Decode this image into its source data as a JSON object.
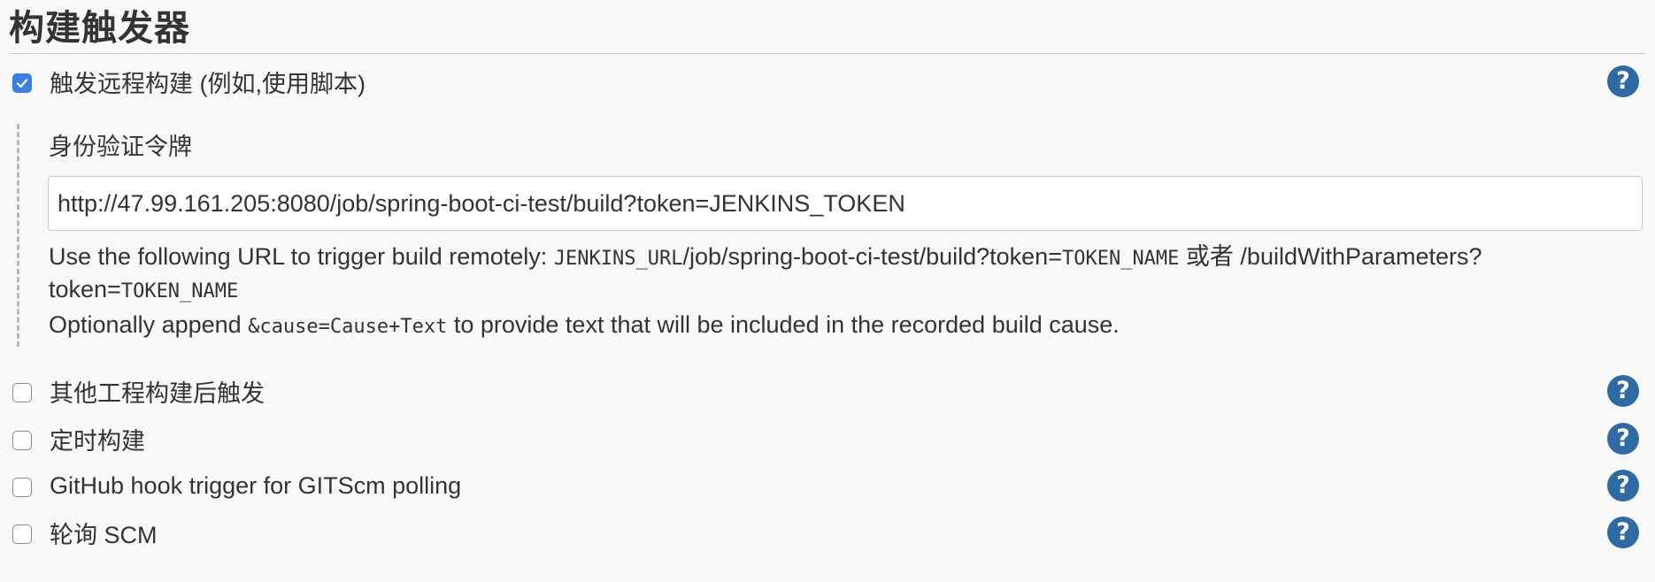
{
  "section": {
    "title": "构建触发器"
  },
  "triggers": [
    {
      "label": "触发远程构建 (例如,使用脚本)",
      "checked": true,
      "help_icon": "question-circle-icon"
    },
    {
      "label": "其他工程构建后触发",
      "checked": false,
      "help_icon": "question-circle-icon"
    },
    {
      "label": "定时构建",
      "checked": false,
      "help_icon": "question-circle-icon"
    },
    {
      "label": "GitHub hook trigger for GITScm polling",
      "checked": false,
      "help_icon": "question-circle-icon"
    },
    {
      "label": "轮询 SCM",
      "checked": false,
      "help_icon": "question-circle-icon"
    }
  ],
  "remote_build": {
    "token_label": "身份验证令牌",
    "token_value": "http://47.99.161.205:8080/job/spring-boot-ci-test/build?token=JENKINS_TOKEN",
    "desc_line1_prefix": "Use the following URL to trigger build remotely: ",
    "desc_line1_code1": "JENKINS_URL",
    "desc_line1_mid": "/job/spring-boot-ci-test/build?token=",
    "desc_line1_code2": "TOKEN_NAME",
    "desc_line1_suffix": " 或者 /buildWithParameters?",
    "desc_line2_prefix": "token=",
    "desc_line2_code": "TOKEN_NAME",
    "desc_line3_prefix": "Optionally append ",
    "desc_line3_code": "&cause=Cause+Text",
    "desc_line3_suffix": " to provide text that will be included in the recorded build cause."
  },
  "help_symbol": "?",
  "colors": {
    "checkbox_checked": "#3c7fe4",
    "help_icon": "#2e6aa3",
    "background": "#f8f8f8"
  }
}
